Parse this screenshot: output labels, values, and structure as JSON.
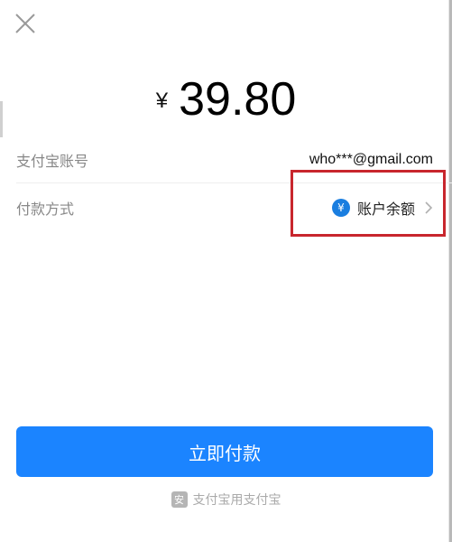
{
  "header": {
    "close_icon": "close-icon"
  },
  "amount": {
    "currency_symbol": "¥",
    "value": "39.80"
  },
  "account_row": {
    "label": "支付宝账号",
    "value": "who***@gmail.com"
  },
  "method_row": {
    "label": "付款方式",
    "icon_glyph": "¥",
    "value": "账户余额",
    "icon": "yuan-circle-icon",
    "chevron": "chevron-right-icon"
  },
  "pay_button": {
    "label": "立即付款"
  },
  "footer": {
    "icon": "shield-icon",
    "icon_glyph": "安",
    "text": "支付宝用支付宝"
  },
  "colors": {
    "primary": "#1b84ff",
    "highlight": "#c8262d",
    "yuan_icon": "#1a7ee0"
  }
}
